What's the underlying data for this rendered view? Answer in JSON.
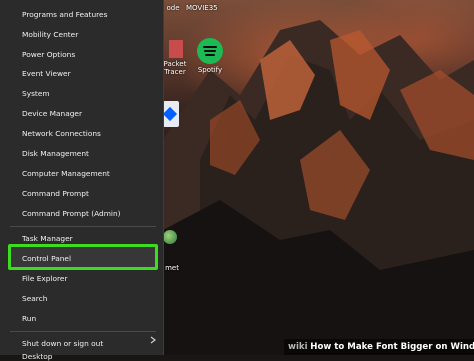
{
  "menu": {
    "items": [
      {
        "label": "Programs and Features"
      },
      {
        "label": "Mobility Center"
      },
      {
        "label": "Power Options"
      },
      {
        "label": "Event Viewer"
      },
      {
        "label": "System"
      },
      {
        "label": "Device Manager"
      },
      {
        "label": "Network Connections"
      },
      {
        "label": "Disk Management"
      },
      {
        "label": "Computer Management"
      },
      {
        "label": "Command Prompt"
      },
      {
        "label": "Command Prompt (Admin)"
      },
      {
        "label": "Task Manager"
      },
      {
        "label": "Control Panel"
      },
      {
        "label": "File Explorer"
      },
      {
        "label": "Search"
      },
      {
        "label": "Run"
      },
      {
        "label": "Shut down or sign out"
      },
      {
        "label": "Desktop"
      }
    ],
    "highlighted_item": "Control Panel",
    "highlight_color": "#3ddc1f"
  },
  "desktop": {
    "icons": [
      {
        "label": "Spotify",
        "icon": "spotify-icon"
      },
      {
        "label": "Packet",
        "icon": "app-icon"
      },
      {
        "label": "Tracer",
        "icon": "app-icon"
      },
      {
        "label": "met",
        "icon": "globe-icon"
      }
    ],
    "partial_top_labels": [
      "ode",
      "MOVIE35"
    ]
  },
  "watermark": {
    "logo": "wiki",
    "title": "How to Make Font Bigger on Windows"
  }
}
